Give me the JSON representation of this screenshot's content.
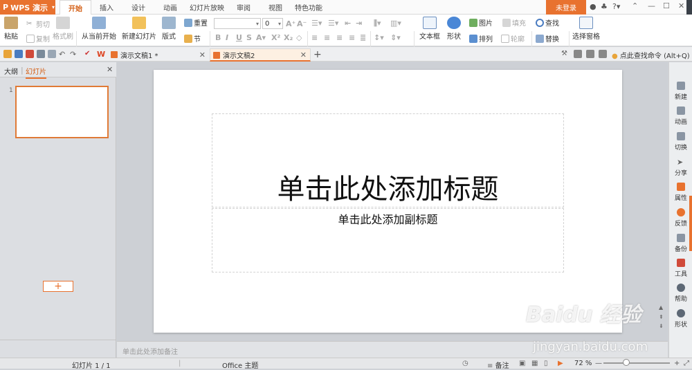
{
  "app": {
    "name": "WPS 演示",
    "login": "未登录"
  },
  "menu_tabs": [
    "开始",
    "插入",
    "设计",
    "动画",
    "幻灯片放映",
    "审阅",
    "视图",
    "特色功能"
  ],
  "ribbon": {
    "paste": "粘贴",
    "cut": "剪切",
    "copy": "复制",
    "format_painter": "格式刷",
    "from_start": "从当前开始",
    "new_slide": "新建幻灯片",
    "layout": "版式",
    "section": "节",
    "reset": "重置",
    "font_size": "0",
    "textbox": "文本框",
    "shape": "形状",
    "picture": "图片",
    "fill": "填充",
    "arrange": "排列",
    "outline": "轮廓",
    "find": "查找",
    "replace": "替换",
    "select_pane": "选择窗格"
  },
  "doc_tabs": [
    {
      "label": "演示文稿1 *"
    },
    {
      "label": "演示文稿2"
    }
  ],
  "search_cmd": "点此查找命令 (Alt+Q)",
  "left_panel": {
    "tab_outline": "大纲",
    "tab_slides": "幻灯片",
    "slide_number": "1"
  },
  "slide": {
    "title": "单击此处添加标题",
    "subtitle": "单击此处添加副标题"
  },
  "notes_placeholder": "单击此处添加备注",
  "right_panel": [
    "新建",
    "动画",
    "切换",
    "分享",
    "属性",
    "反馈",
    "备份",
    "工具",
    "帮助",
    "形状"
  ],
  "status": {
    "slide_count": "幻灯片 1 / 1",
    "theme": "Office 主题",
    "notes": "备注",
    "zoom": "72 %"
  },
  "watermark": {
    "line1": "Baidu 经验",
    "line2": "jingyan.baidu.com"
  },
  "colors": {
    "accent": "#e8722f"
  }
}
